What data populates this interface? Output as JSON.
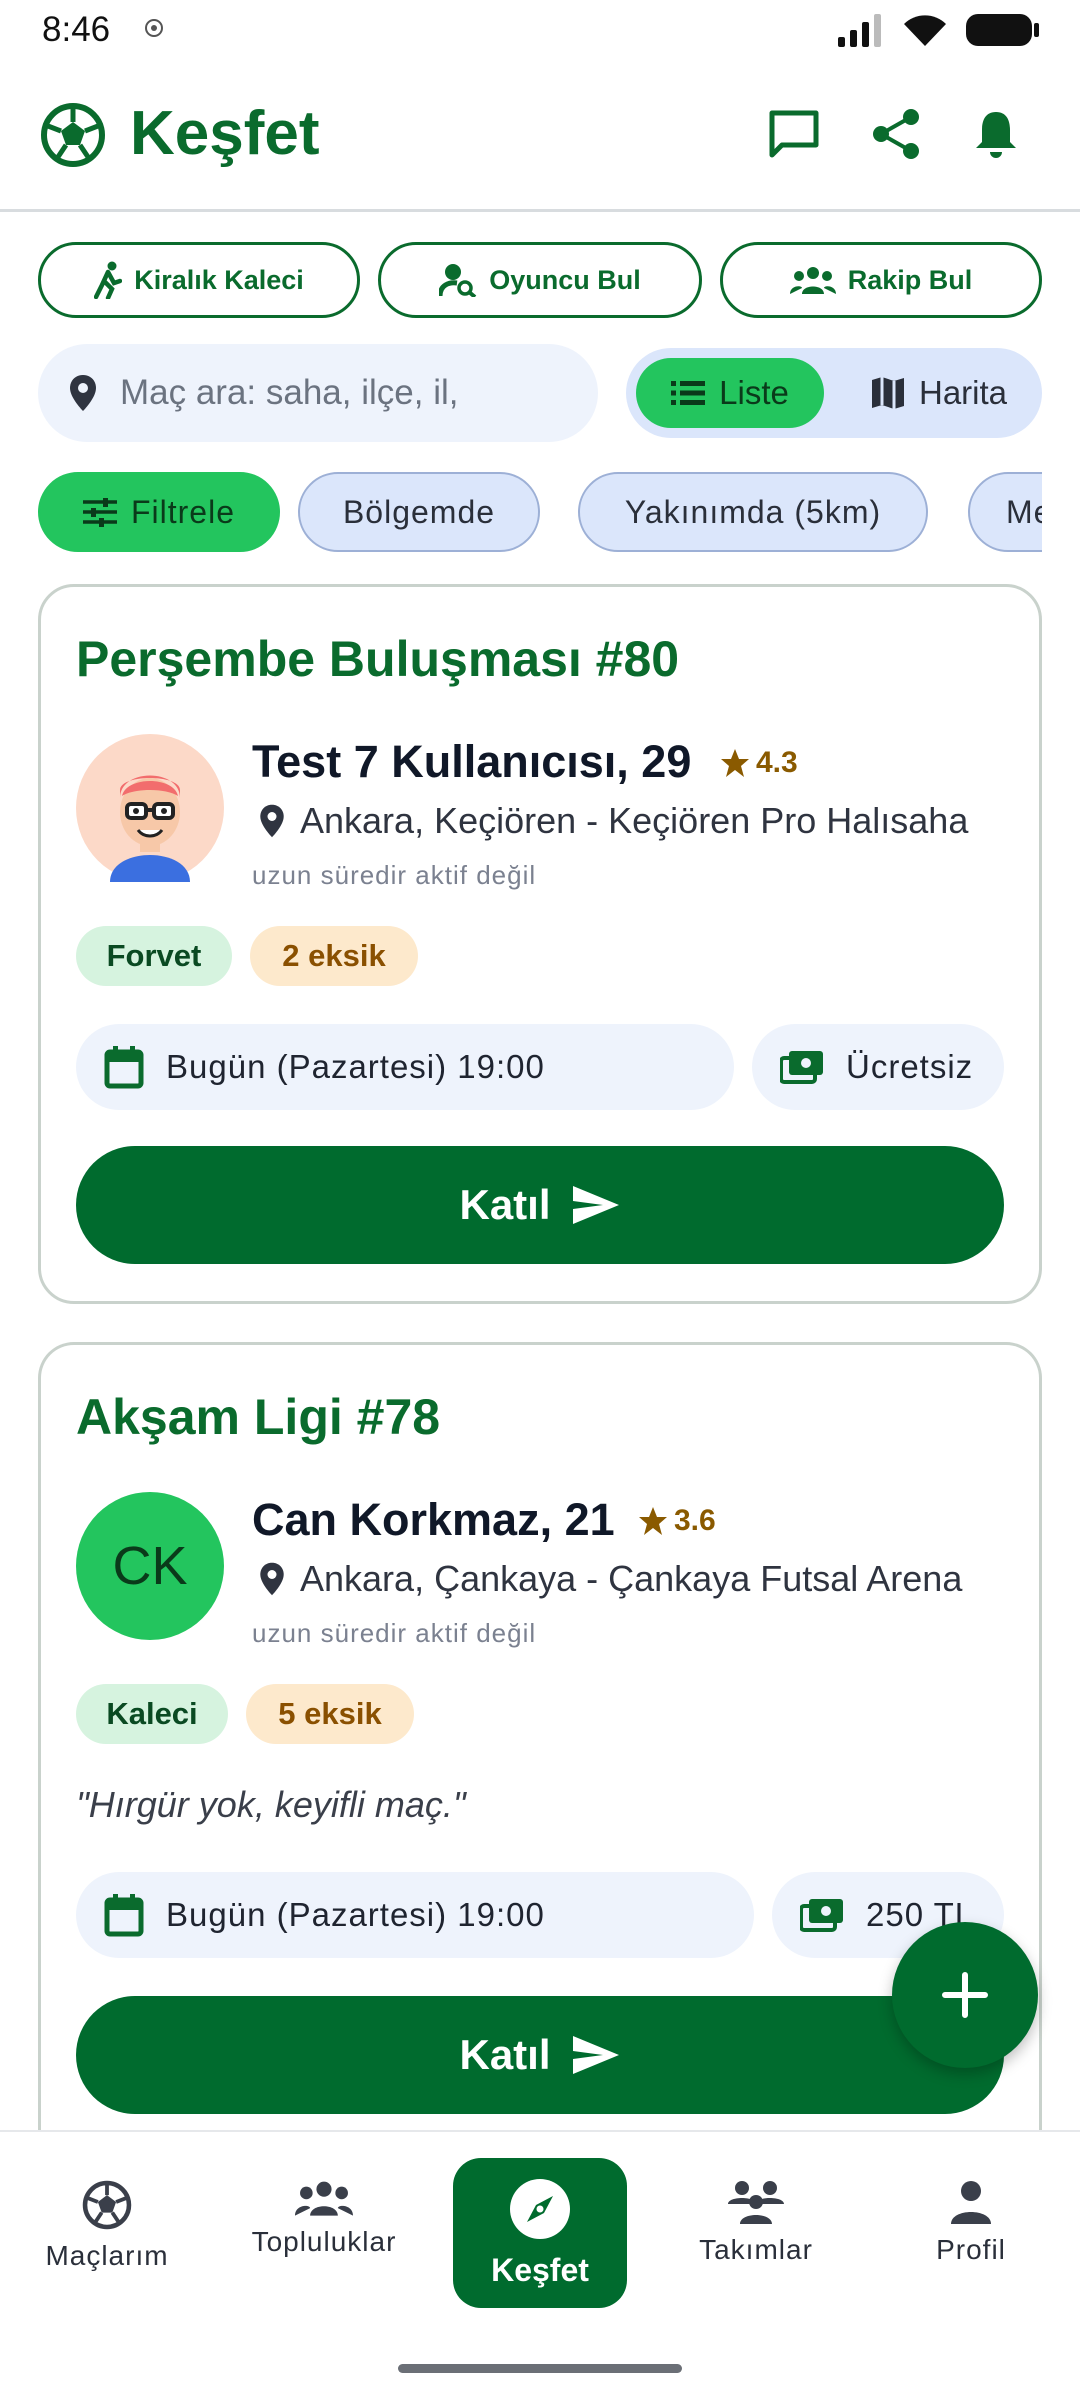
{
  "status_bar": {
    "time": "8:46"
  },
  "app_bar": {
    "title": "Keşfet"
  },
  "quick_actions": [
    {
      "label": "Kiralık Kaleci",
      "icon": "running-person-icon"
    },
    {
      "label": "Oyuncu Bul",
      "icon": "person-search-icon"
    },
    {
      "label": "Rakip Bul",
      "icon": "group-icon"
    }
  ],
  "search": {
    "placeholder": "Maç ara: saha, ilçe, il,"
  },
  "view_toggle": {
    "list_label": "Liste",
    "map_label": "Harita",
    "selected": "Liste"
  },
  "chips": [
    "Filtrele",
    "Bölgemde",
    "Yakınımda (5km)",
    "Me"
  ],
  "matches": [
    {
      "title": "Perşembe Buluşması #80",
      "host": "Test 7 Kullanıcısı, 29",
      "rating": "4.3",
      "location": "Ankara, Keçiören - Keçiören Pro Halısaha",
      "activity": "uzun süredir aktif değil",
      "position": "Forvet",
      "missing": "2 eksik",
      "datetime": "Bugün (Pazartesi) 19:00",
      "fee": "Ücretsiz",
      "join_label": "Katıl"
    },
    {
      "title": "Akşam Ligi #78",
      "host": "Can Korkmaz, 21",
      "initials": "CK",
      "rating": "3.6",
      "location": "Ankara, Çankaya - Çankaya Futsal Arena",
      "activity": "uzun süredir aktif değil",
      "position": "Kaleci",
      "missing": "5 eksik",
      "quote": "\"Hırgür yok, keyifli maç.\"",
      "datetime": "Bugün (Pazartesi) 19:00",
      "fee": "250 TL",
      "join_label": "Katıl"
    }
  ],
  "bottom_nav": [
    {
      "label": "Maçlarım",
      "icon": "soccer-ball-icon"
    },
    {
      "label": "Topluluklar",
      "icon": "groups-icon"
    },
    {
      "label": "Keşfet",
      "icon": "compass-icon",
      "active": true
    },
    {
      "label": "Takımlar",
      "icon": "team-icon"
    },
    {
      "label": "Profil",
      "icon": "person-icon"
    }
  ],
  "colors": {
    "primary": "#006b2e",
    "accent_green": "#23c55e",
    "chip_bg": "#dbe6fb",
    "rating": "#8a5a00"
  }
}
